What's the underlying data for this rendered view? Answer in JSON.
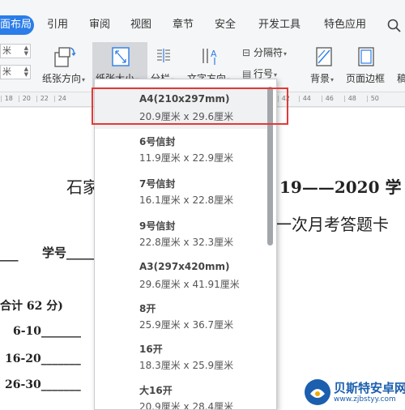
{
  "tabs": [
    {
      "label": "页面布局",
      "active": true
    },
    {
      "label": "引用"
    },
    {
      "label": "审阅"
    },
    {
      "label": "视图"
    },
    {
      "label": "章节"
    },
    {
      "label": "安全"
    },
    {
      "label": "开发工具"
    },
    {
      "label": "特色应用"
    }
  ],
  "active_tab_visible": "面布局",
  "ribbon": {
    "paper_direction": "纸张方向",
    "paper_size": "纸张大小",
    "columns": "分栏",
    "text_direction": "文字方向",
    "separator": "分隔符",
    "line_number": "行号",
    "background": "背景",
    "page_border": "页面边框",
    "spin_values": [
      "米",
      "米"
    ],
    "partial_right": "稿"
  },
  "ruler_ticks": [
    "18",
    "20",
    "22",
    "24",
    "42",
    "44",
    "46",
    "48",
    "50"
  ],
  "paper_sizes": [
    {
      "name": "A4(210x297mm)",
      "size": "20.9厘米 x 29.6厘米",
      "selected": true
    },
    {
      "name": "6号信封",
      "size": "11.9厘米 x 22.9厘米"
    },
    {
      "name": "7号信封",
      "size": "16.1厘米 x 22.8厘米"
    },
    {
      "name": "9号信封",
      "size": "22.8厘米 x 32.3厘米"
    },
    {
      "name": "A3(297x420mm)",
      "size": "29.6厘米 x 41.91厘米"
    },
    {
      "name": "8开",
      "size": "25.9厘米 x 36.7厘米"
    },
    {
      "name": "16开",
      "size": "18.3厘米 x 25.9厘米"
    },
    {
      "name": "大16开",
      "size": "20.9厘米 x 28.4厘米"
    }
  ],
  "document": {
    "title_left": "石家",
    "title_right": "19——2020 学",
    "subtitle_right": "一次月考答题卡",
    "student_no": "学号",
    "section": "合计 62 分)",
    "rows": [
      "6-10",
      "16-20",
      "26-30"
    ]
  },
  "watermark": {
    "name": "贝斯特安卓网",
    "url": "www.zjbstyy.com"
  },
  "colors": {
    "accent": "#2b7de9",
    "highlight_box": "#e23a37",
    "watermark": "#1b5fae"
  }
}
